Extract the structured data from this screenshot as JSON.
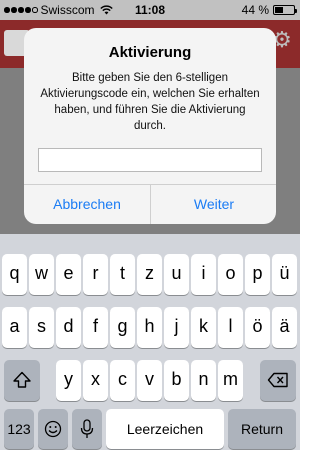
{
  "status_bar": {
    "carrier": "Swisscom",
    "time": "11:08",
    "battery_percent": "44 %",
    "battery_level": 0.44,
    "signal_bars": 4
  },
  "app": {
    "header_color": "#8c2a2a"
  },
  "alert": {
    "title": "Aktivierung",
    "message": "Bitte geben Sie den 6-stelligen Aktivierungscode ein, welchen Sie erhalten haben, und führen Sie die Aktivierung durch.",
    "input_value": "",
    "cancel_label": "Abbrechen",
    "confirm_label": "Weiter",
    "accent_color": "#1b7cf4"
  },
  "keyboard": {
    "row1": [
      "q",
      "w",
      "e",
      "r",
      "t",
      "z",
      "u",
      "i",
      "o",
      "p",
      "ü"
    ],
    "row2": [
      "a",
      "s",
      "d",
      "f",
      "g",
      "h",
      "j",
      "k",
      "l",
      "ö",
      "ä"
    ],
    "row3": [
      "y",
      "x",
      "c",
      "v",
      "b",
      "n",
      "m"
    ],
    "numbers_label": "123",
    "space_label": "Leerzeichen",
    "return_label": "Return",
    "shift_icon": "shift-icon",
    "delete_icon": "backspace-icon",
    "emoji_icon": "emoji-icon",
    "mic_icon": "microphone-icon"
  }
}
